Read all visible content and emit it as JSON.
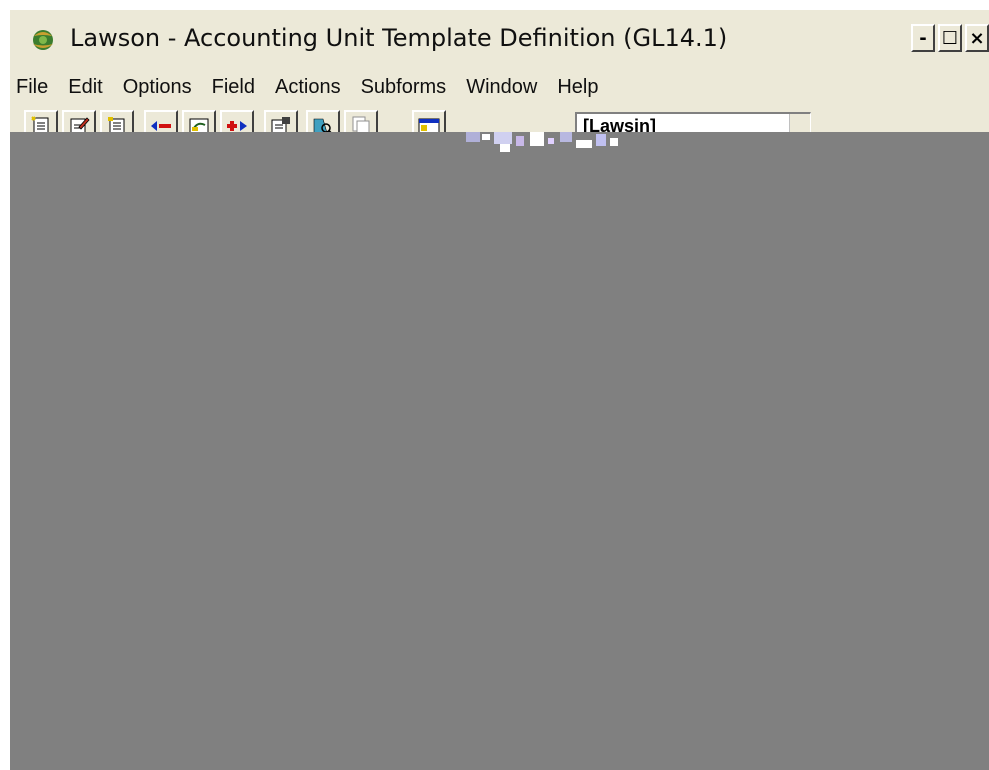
{
  "window": {
    "title": "Lawson - Accounting Unit Template Definition (GL14.1)",
    "controls": {
      "minimize": "-",
      "maximize": "☐",
      "close": "×"
    }
  },
  "menu": [
    "File",
    "Edit",
    "Options",
    "Field",
    "Actions",
    "Subforms",
    "Window",
    "Help"
  ],
  "toolbar": {
    "icons": [
      "add-icon",
      "change-icon",
      "inquire-icon",
      "previous-icon",
      "delete-icon",
      "next-icon",
      "define-icon",
      "find-icon",
      "copy-icon",
      "window-icon"
    ],
    "combo_value": "[Lawsin]"
  },
  "colors": {
    "chrome": "#ece9d8",
    "workspace": "#808080",
    "arrow_blue": "#1030c0",
    "arrow_red": "#d01010"
  }
}
